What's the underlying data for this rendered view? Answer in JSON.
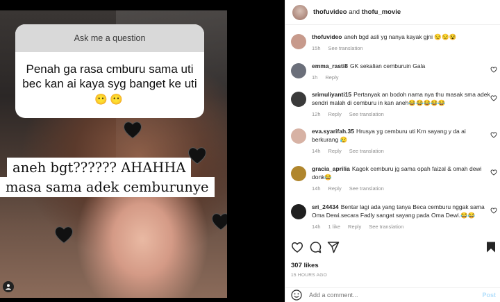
{
  "story": {
    "question_header": "Ask me a question",
    "question_text": "Penah ga rasa cmburu sama uti bec kan ai kaya syg banget ke uti",
    "question_emojis": "😶😶",
    "caption_line1": "aneh bgt?????? AHAHHA",
    "caption_line2": "masa sama adek cemburunye"
  },
  "header": {
    "user1": "thofuvideo",
    "and": "and",
    "user2": "thofu_movie"
  },
  "comments": [
    {
      "username": "thofuvideo",
      "text": "aneh bgd asli yg nanya kayak gjni 😒😒😵",
      "time": "15h",
      "likes": "",
      "reply": "",
      "translation": "See translation",
      "avatar_color": "#c79a8c"
    },
    {
      "username": "emma_rasti8",
      "text": "GK sekalian cemburuin Gala",
      "time": "1h",
      "likes": "",
      "reply": "Reply",
      "translation": "",
      "avatar_color": "#6b6f7a"
    },
    {
      "username": "srimuliyanti15",
      "text": "Pertanyak an bodoh nama nya thu masak sma adek sendri malah di cemburu in kan aneh😂😂😂😂😂",
      "time": "12h",
      "likes": "",
      "reply": "Reply",
      "translation": "See translation",
      "avatar_color": "#3a3a3a"
    },
    {
      "username": "eva.syarifah.35",
      "text": "Hrusya yg cemburu uti Krn sayang y da ai berkurang 😥",
      "time": "14h",
      "likes": "",
      "reply": "Reply",
      "translation": "See translation",
      "avatar_color": "#d7b2a4"
    },
    {
      "username": "gracia_aprilia",
      "text": "Kagok cemburu jg sama opah faizal & omah dewi donk😂",
      "time": "14h",
      "likes": "",
      "reply": "Reply",
      "translation": "See translation",
      "avatar_color": "#b0862d"
    },
    {
      "username": "sri_24434",
      "text": "Bentar lagi ada yang tanya Beca cemburu nggak sama Oma Dewi.secara Fadly sangat sayang pada Oma Dewi.😂😂",
      "time": "14h",
      "likes": "1 like",
      "reply": "Reply",
      "translation": "See translation",
      "avatar_color": "#1f1f1f"
    }
  ],
  "likes": "307 likes",
  "time_ago": "15 HOURS AGO",
  "add_comment": {
    "placeholder": "Add a comment...",
    "post_label": "Post"
  },
  "icons": {
    "heart": "heart-icon",
    "comment": "comment-icon",
    "share": "share-icon",
    "save": "bookmark-icon",
    "emoji": "smiley-icon",
    "user_tag": "user-tag-icon"
  }
}
